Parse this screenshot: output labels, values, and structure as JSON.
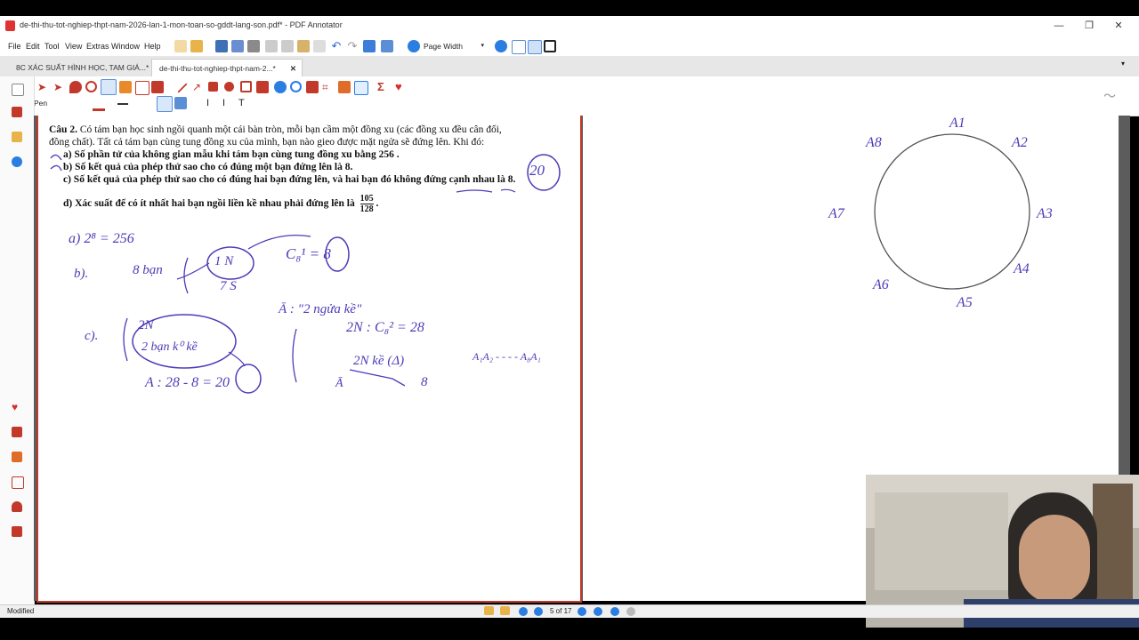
{
  "window": {
    "title": "de-thi-thu-tot-nghiep-thpt-nam-2026-lan-1-mon-toan-so-gddt-lang-son.pdf* - PDF Annotator"
  },
  "menu": [
    "File",
    "Edit",
    "Tool",
    "View",
    "Extras",
    "Window",
    "Help"
  ],
  "toolbar": {
    "zoom_mode": "Page Width"
  },
  "tabs": [
    {
      "label": "8C XÁC SUẤT HÌNH HỌC, TAM GIÁ...*"
    },
    {
      "label": "de-thi-thu-tot-nghiep-thpt-nam-2...*"
    }
  ],
  "pen_tool": {
    "label": "Pen"
  },
  "question": {
    "head": "Câu 2.",
    "line1": "Có tám bạn học sinh ngồi quanh một cái bàn tròn, mỗi bạn cầm một đồng xu (các đồng xu đều cân đối,",
    "line2": "đồng chất). Tất cả tám bạn cùng tung đồng xu của mình, bạn nào gieo được mặt ngửa sẽ đứng lên. Khi đó:",
    "a": "a)  Số phần tử của không gian mẫu khi tám bạn cùng tung đồng xu bằng 256 .",
    "b": "b)  Số kết quả của phép thử sao cho có đúng một bạn đứng lên là 8.",
    "c": "c)  Số kết quả của phép thử sao cho có đúng hai bạn đứng lên, và hai bạn đó không đứng cạnh nhau là 8.",
    "d_text": "d)  Xác suất để có ít nhất hai bạn ngồi liền kề nhau phải đứng lên là",
    "d_num": "105",
    "d_den": "128",
    "d_end": "."
  },
  "handwriting": {
    "c_answer": "20",
    "a_work": "a)  2⁸ = 256",
    "b_label": "b).",
    "b_eight": "8 bạn",
    "b_one_n": "1 N",
    "b_seven": "7 S",
    "b_comb": "C₈¹ = 8",
    "c_label": "c).",
    "c_2n": "2N",
    "c_2ban": "2 bạn k⁰ kề",
    "c_abar": "Ā : \"2 ngửa kề\"",
    "c_comb": "2N : C₈² = 28",
    "c_adj": "2N kề (Δ)",
    "c_a1a2": "A₁A₂ - - - - A₈A₁",
    "c_abar2": "Ā",
    "c_eight": "8",
    "c_result": "A : 28 - 8 = 20"
  },
  "circle_labels": [
    "A1",
    "A2",
    "A3",
    "A4",
    "A5",
    "A6",
    "A7",
    "A8"
  ],
  "status": {
    "left": "Modified",
    "page": "5 of 17"
  },
  "colors": {
    "accent": "#c0392b",
    "ink": "#4b3cb8",
    "selected_tab": "#ffffff"
  }
}
